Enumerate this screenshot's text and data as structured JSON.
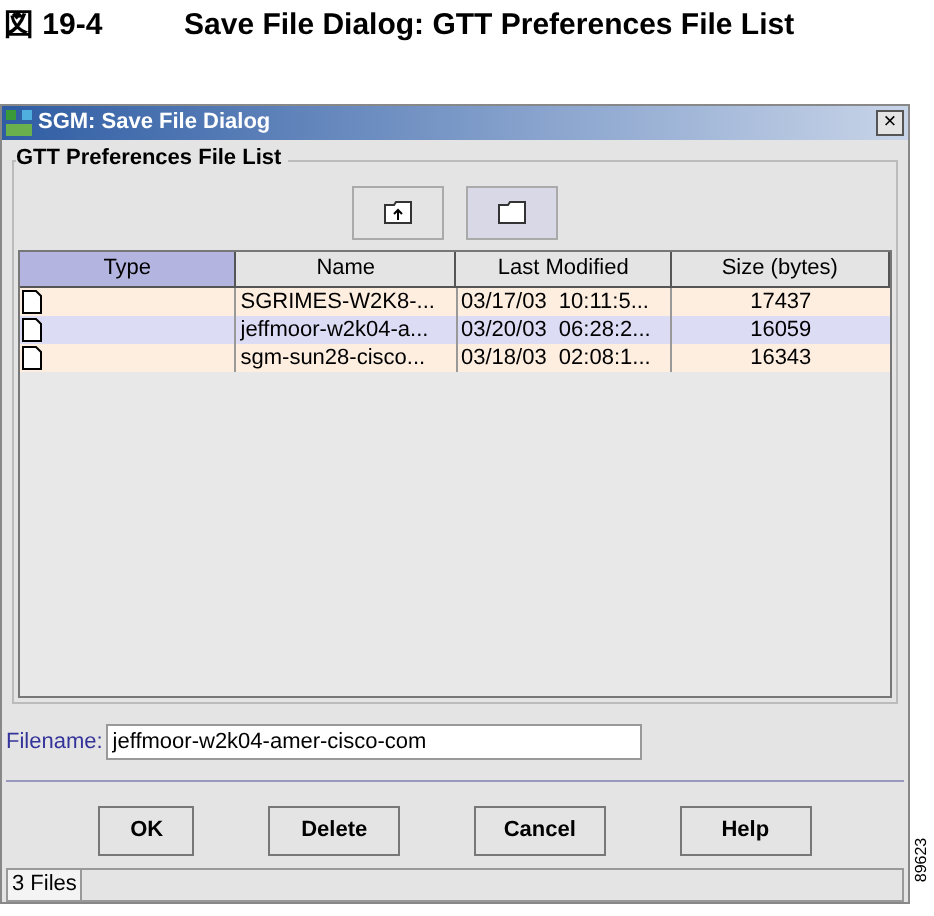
{
  "caption": {
    "number": "図 19-4",
    "title": "Save File Dialog: GTT Preferences File List"
  },
  "window": {
    "title": "SGM: Save File Dialog",
    "close": "×"
  },
  "group": {
    "title": "GTT Preferences File List"
  },
  "table": {
    "columns": [
      {
        "label": "Type",
        "selected": true
      },
      {
        "label": "Name",
        "selected": false
      },
      {
        "label": "Last Modified",
        "selected": false
      },
      {
        "label": "Size (bytes)",
        "selected": false
      }
    ],
    "rows": [
      {
        "name": "SGRIMES-W2K8-...",
        "modified": "03/17/03  10:11:5...",
        "size": "17437",
        "selected": false
      },
      {
        "name": "jeffmoor-w2k04-a...",
        "modified": "03/20/03  06:28:2...",
        "size": "16059",
        "selected": true
      },
      {
        "name": "sgm-sun28-cisco...",
        "modified": "03/18/03  02:08:1...",
        "size": "16343",
        "selected": false
      }
    ]
  },
  "filename": {
    "label": "Filename:",
    "value": "jeffmoor-w2k04-amer-cisco-com"
  },
  "buttons": [
    "OK",
    "Delete",
    "Cancel",
    "Help"
  ],
  "status_bar": {
    "text": "3 Files"
  },
  "figure_id": "89623"
}
